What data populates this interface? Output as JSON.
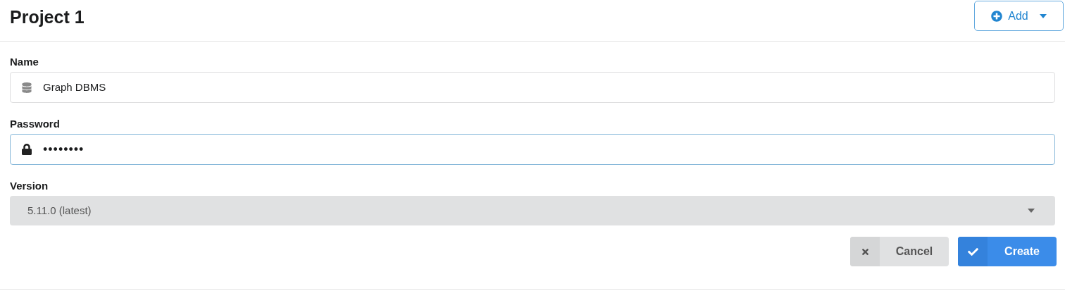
{
  "header": {
    "title": "Project 1",
    "add_button": "Add"
  },
  "fields": [
    {
      "kind": "text",
      "label": "Name",
      "value": "Graph DBMS",
      "focused": false
    },
    {
      "kind": "password",
      "label": "Password",
      "value": "••••••••",
      "focused": true
    },
    {
      "kind": "select",
      "label": "Version",
      "value": "5.11.0 (latest)",
      "focused": false
    }
  ],
  "buttons": [
    {
      "kind": "cancel",
      "label": "Cancel"
    },
    {
      "kind": "create",
      "label": "Create"
    }
  ]
}
